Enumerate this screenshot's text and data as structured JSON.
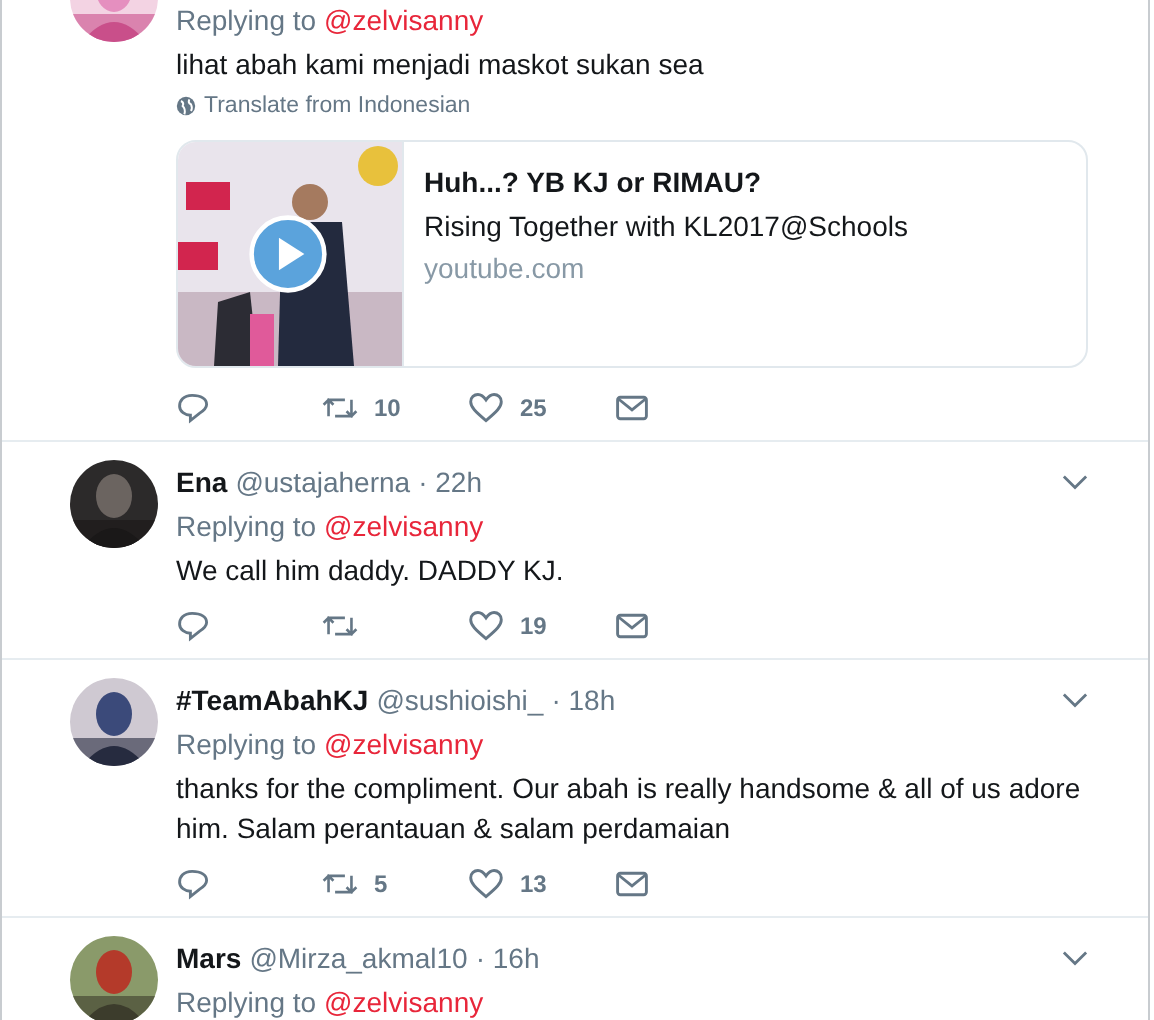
{
  "tweets": [
    {
      "replying_label": "Replying to",
      "replying_to": "@zelvisanny",
      "text": "lihat abah kami menjadi maskot sukan sea",
      "translate": "Translate from Indonesian",
      "card": {
        "title": "Huh...? YB KJ or RIMAU?",
        "description": "Rising Together with KL2017@Schools",
        "domain": "youtube.com"
      },
      "retweets": "10",
      "likes": "25"
    },
    {
      "name": "Ena",
      "handle": "@ustajaherna",
      "time": "· 22h",
      "replying_label": "Replying to",
      "replying_to": "@zelvisanny",
      "text": "We call him daddy. DADDY KJ.",
      "likes": "19"
    },
    {
      "name": "#TeamAbahKJ",
      "handle": "@sushioishi_",
      "time": "· 18h",
      "replying_label": "Replying to",
      "replying_to": "@zelvisanny",
      "text": "thanks for the compliment. Our abah is really handsome & all of us adore him. Salam perantauan & salam perdamaian",
      "retweets": "5",
      "likes": "13"
    },
    {
      "name": "Mars",
      "handle": "@Mirza_akmal10",
      "time": "· 16h",
      "replying_label": "Replying to",
      "replying_to": "@zelvisanny"
    }
  ]
}
